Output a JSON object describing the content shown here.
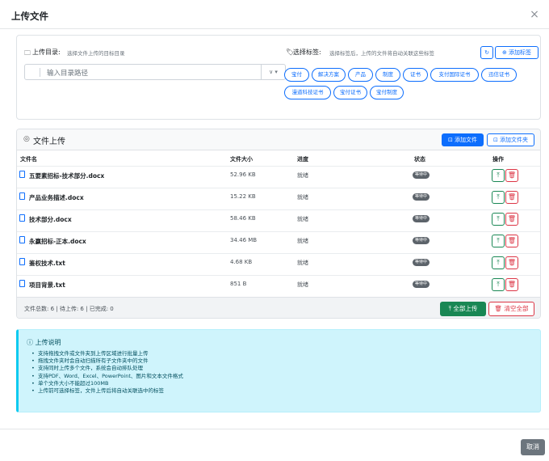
{
  "dialog": {
    "title": "上传文件",
    "close_label": "×"
  },
  "target_dir": {
    "label": "上传目录:",
    "hint": "选择文件上传的目标目录",
    "placeholder": "输入目录路径",
    "caret": "∨ ▾"
  },
  "tags": {
    "label": "选择标签:",
    "hint": "选择标签后，上传的文件将自动关联这些标签",
    "refresh_icon": "↻",
    "add_label": "⊕ 添加标签",
    "items": [
      "宝付",
      "解决方案",
      "产品",
      "制度",
      "证书",
      "支付国际证书",
      "迅信证书",
      "漫道科技证书",
      "宝付证书",
      "宝付制度"
    ]
  },
  "files": {
    "title": "文件上传",
    "add_file_label": "⊡ 添加文件",
    "add_folder_label": "⊡ 添加文件夹",
    "columns": {
      "name": "文件名",
      "size": "文件大小",
      "progress": "进度",
      "status": "状态",
      "actions": "操作"
    },
    "rows": [
      {
        "name": "五要素招标-技术部分.docx",
        "size": "52.96 KB",
        "progress": "就绪",
        "status": "等待中"
      },
      {
        "name": "产品业务描述.docx",
        "size": "15.22 KB",
        "progress": "就绪",
        "status": "等待中"
      },
      {
        "name": "技术部分.docx",
        "size": "58.46 KB",
        "progress": "就绪",
        "status": "等待中"
      },
      {
        "name": "永赢招标-正本.docx",
        "size": "34.46 MB",
        "progress": "就绪",
        "status": "等待中"
      },
      {
        "name": "鉴权技术.txt",
        "size": "4.68 KB",
        "progress": "就绪",
        "status": "等待中"
      },
      {
        "name": "项目背景.txt",
        "size": "851 B",
        "progress": "就绪",
        "status": "等待中"
      }
    ],
    "upload_icon": "⤒",
    "delete_icon": "🗑",
    "stats": "文件总数: 6 | 待上传: 6 | 已完成: 0",
    "upload_all_label": "⤒ 全部上传",
    "clear_all_label": "🗑 清空全部"
  },
  "info": {
    "title": "ⓘ 上传说明",
    "items": [
      "支持拖拽文件或文件夹到上传区域进行批量上传",
      "拖拽文件夹时会自动扫描所有子文件夹中的文件",
      "支持同时上传多个文件，系统会自动排队处理",
      "支持PDF、Word、Excel、PowerPoint、图片和文本文件格式",
      "单个文件大小不能超过100MB",
      "上传前可选择标签，文件上传后将自动关联选中的标签"
    ]
  },
  "footer": {
    "cancel_label": "取消"
  },
  "colors": {
    "primary": "#0d6efd",
    "success": "#198754",
    "danger": "#dc3545",
    "info_bg": "#cff4fc",
    "badge": "#5c636a"
  }
}
